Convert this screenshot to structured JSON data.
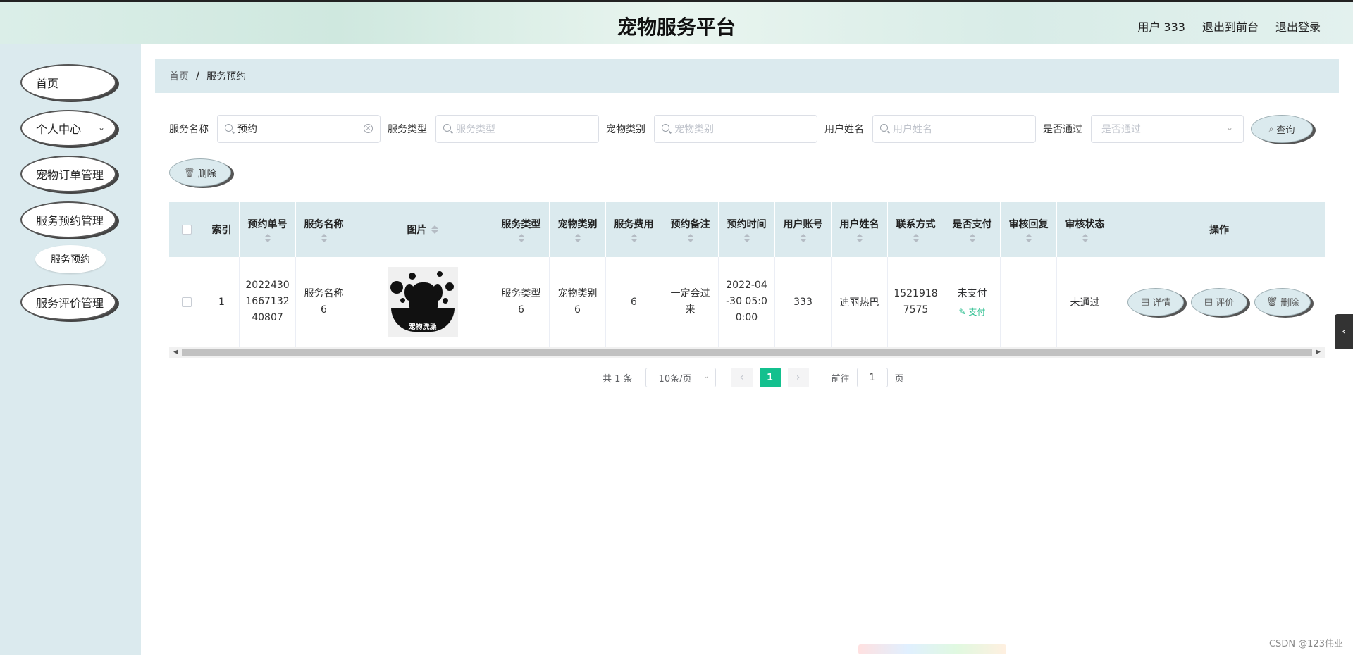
{
  "header": {
    "title": "宠物服务平台",
    "user_label": "用户 333",
    "to_front": "退出到前台",
    "logout": "退出登录"
  },
  "sidebar": {
    "items": [
      {
        "label": "首页"
      },
      {
        "label": "个人中心"
      },
      {
        "label": "宠物订单管理"
      },
      {
        "label": "服务预约管理"
      },
      {
        "label": "服务预约"
      },
      {
        "label": "服务评价管理"
      }
    ]
  },
  "breadcrumb": {
    "home": "首页",
    "sep": "/",
    "current": "服务预约"
  },
  "search": {
    "service_name_label": "服务名称",
    "service_name_value": "预约",
    "service_type_label": "服务类型",
    "service_type_placeholder": "服务类型",
    "pet_category_label": "宠物类别",
    "pet_category_placeholder": "宠物类别",
    "user_name_label": "用户姓名",
    "user_name_placeholder": "用户姓名",
    "passed_label": "是否通过",
    "passed_placeholder": "是否通过",
    "query_button": "查询",
    "delete_button": "删除"
  },
  "table": {
    "columns": [
      "索引",
      "预约单号",
      "服务名称",
      "图片",
      "服务类型",
      "宠物类别",
      "服务费用",
      "预约备注",
      "预约时间",
      "用户账号",
      "用户姓名",
      "联系方式",
      "是否支付",
      "审核回复",
      "审核状态",
      "操作"
    ],
    "rows": [
      {
        "index": "1",
        "order_no": "20224301667132 40807",
        "order_no_lines": [
          "2022430",
          "1667132",
          "40807"
        ],
        "service_name_lines": [
          "服务名称",
          "6"
        ],
        "image_caption": "宠物洗澡",
        "service_type_lines": [
          "服务类型",
          "6"
        ],
        "pet_category_lines": [
          "宠物类别",
          "6"
        ],
        "fee": "6",
        "remark_lines": [
          "一定会过",
          "来"
        ],
        "time_lines": [
          "2022-04",
          "-30 05:0",
          "0:00"
        ],
        "account": "333",
        "user_name": "迪丽热巴",
        "phone_lines": [
          "1521918",
          "7575"
        ],
        "paid": "未支付",
        "pay_link": "支付",
        "reply": "",
        "status": "未通过",
        "actions": {
          "detail": "详情",
          "review": "评价",
          "delete": "删除"
        }
      }
    ]
  },
  "pagination": {
    "total": "共 1 条",
    "page_size": "10条/页",
    "current_page": "1",
    "goto_label": "前往",
    "goto_value": "1",
    "page_unit": "页"
  },
  "watermark": "CSDN @123伟业",
  "colors": {
    "accent": "#13c08e",
    "panel": "#dbeaee",
    "pay_link": "#2bbf8f"
  }
}
